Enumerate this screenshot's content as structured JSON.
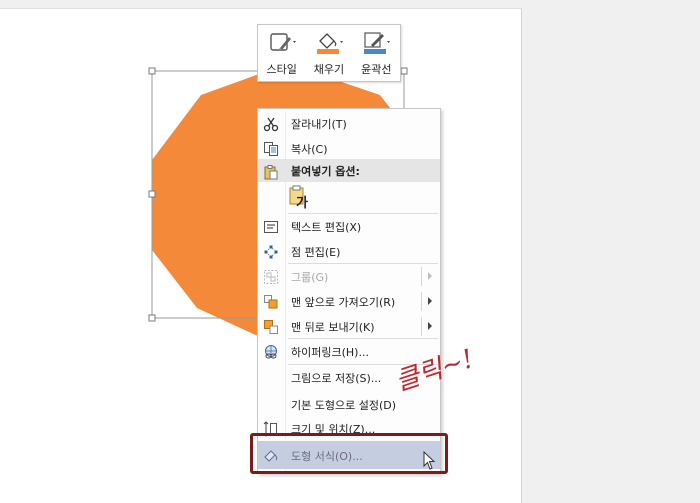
{
  "mini_toolbar": {
    "buttons": [
      {
        "label": "스타일",
        "icon": "shape-style-icon"
      },
      {
        "label": "채우기",
        "icon": "paint-bucket-icon",
        "color": "#f5893a"
      },
      {
        "label": "윤곽선",
        "icon": "pen-outline-icon",
        "color": "#4a86c8"
      }
    ]
  },
  "context_menu": {
    "items": [
      {
        "label": "잘라내기(T)",
        "icon": "scissors-icon"
      },
      {
        "label": "복사(C)",
        "icon": "copy-icon"
      },
      {
        "label": "붙여넣기 옵션:",
        "icon": "paste-icon"
      },
      {
        "label": "텍스트 편집(X)",
        "icon": "edit-text-icon"
      },
      {
        "label": "점 편집(E)",
        "icon": "edit-points-icon"
      },
      {
        "label": "그룹(G)",
        "icon": "group-icon",
        "disabled": true
      },
      {
        "label": "맨 앞으로 가져오기(R)",
        "icon": "bring-to-front-icon"
      },
      {
        "label": "맨 뒤로 보내기(K)",
        "icon": "send-to-back-icon"
      },
      {
        "label": "하이퍼링크(H)...",
        "icon": "hyperlink-icon"
      },
      {
        "label": "그림으로 저장(S)...",
        "icon": ""
      },
      {
        "label": "기본 도형으로 설정(D)",
        "icon": ""
      },
      {
        "label": "크기 및 위치(Z)...",
        "icon": "size-position-icon"
      },
      {
        "label": "도형 서식(O)...",
        "icon": "format-shape-icon"
      }
    ],
    "paste_glyph": "가"
  },
  "annotation": {
    "text": "클릭~!",
    "color": "#c0272d"
  },
  "shape": {
    "fill": "#f5893a"
  }
}
